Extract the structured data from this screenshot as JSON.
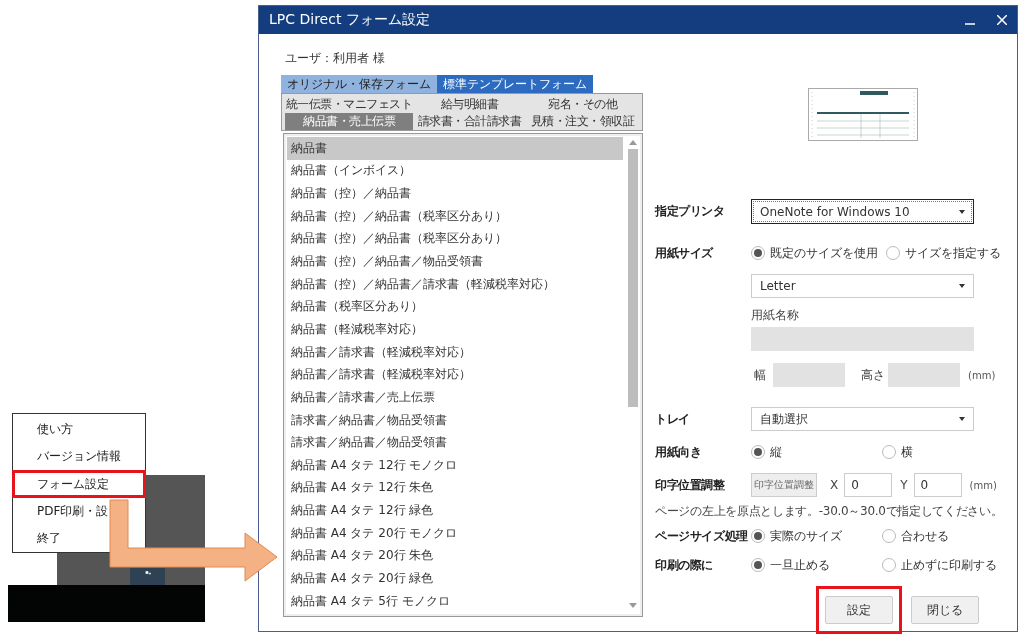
{
  "context_menu": {
    "items": [
      {
        "label": "使い方",
        "highlighted": false
      },
      {
        "label": "バージョン情報",
        "highlighted": false
      },
      {
        "label": "フォーム設定",
        "highlighted": true
      },
      {
        "label": "PDF印刷・設",
        "highlighted": false
      },
      {
        "label": "終了",
        "highlighted": false
      }
    ]
  },
  "window": {
    "title": "LPC Direct フォーム設定"
  },
  "user_label": "ユーザ：利用者 様",
  "source_tabs": [
    {
      "label": "オリジナル・保存フォーム",
      "selected": false
    },
    {
      "label": "標準テンプレートフォーム",
      "selected": true
    }
  ],
  "category_tab_rows": [
    {
      "tabs": [
        {
          "label": "統一伝票・マニフェスト",
          "selected": false
        },
        {
          "label": "給与明細書",
          "selected": false
        },
        {
          "label": "宛名・その他",
          "selected": false
        }
      ]
    },
    {
      "tabs": [
        {
          "label": "納品書・売上伝票",
          "selected": true
        },
        {
          "label": "請求書・合計請求書",
          "selected": false
        },
        {
          "label": "見積・注文・領収証",
          "selected": false
        }
      ]
    }
  ],
  "form_list": {
    "items": [
      {
        "label": "納品書",
        "selected": true
      },
      {
        "label": "納品書（インボイス）",
        "selected": false
      },
      {
        "label": "納品書（控）／納品書",
        "selected": false
      },
      {
        "label": "納品書（控）／納品書（税率区分あり）",
        "selected": false
      },
      {
        "label": "納品書（控）／納品書（税率区分あり）",
        "selected": false
      },
      {
        "label": "納品書（控）／納品書／物品受領書",
        "selected": false
      },
      {
        "label": "納品書（控）／納品書／請求書（軽減税率対応）",
        "selected": false
      },
      {
        "label": "納品書（税率区分あり）",
        "selected": false
      },
      {
        "label": "納品書（軽減税率対応）",
        "selected": false
      },
      {
        "label": "納品書／請求書（軽減税率対応）",
        "selected": false
      },
      {
        "label": "納品書／請求書（軽減税率対応）",
        "selected": false
      },
      {
        "label": "納品書／請求書／売上伝票",
        "selected": false
      },
      {
        "label": "請求書／納品書／物品受領書",
        "selected": false
      },
      {
        "label": "請求書／納品書／物品受領書",
        "selected": false
      },
      {
        "label": "納品書 A4 タテ 12行 モノクロ",
        "selected": false
      },
      {
        "label": "納品書 A4 タテ 12行 朱色",
        "selected": false
      },
      {
        "label": "納品書 A4 タテ 12行 緑色",
        "selected": false
      },
      {
        "label": "納品書 A4 タテ 20行 モノクロ",
        "selected": false
      },
      {
        "label": "納品書 A4 タテ 20行 朱色",
        "selected": false
      },
      {
        "label": "納品書 A4 タテ 20行 緑色",
        "selected": false
      },
      {
        "label": "納品書 A4 タテ 5行 モノクロ",
        "selected": false
      }
    ]
  },
  "printer": {
    "label": "指定プリンタ",
    "value": "OneNote for Windows 10"
  },
  "paper_size": {
    "label": "用紙サイズ",
    "options": [
      {
        "label": "既定のサイズを使用",
        "selected": true
      },
      {
        "label": "サイズを指定する",
        "selected": false
      }
    ],
    "size_value": "Letter",
    "name_label": "用紙名称",
    "width_label": "幅",
    "height_label": "高さ",
    "unit": "(mm)"
  },
  "tray": {
    "label": "トレイ",
    "value": "自動選択"
  },
  "orientation": {
    "label": "用紙向き",
    "options": [
      {
        "label": "縦",
        "selected": true
      },
      {
        "label": "横",
        "selected": false
      }
    ]
  },
  "offset": {
    "label": "印字位置調整",
    "button": "印字位置調整",
    "x_label": "X",
    "x_value": "0",
    "y_label": "Y",
    "y_value": "0",
    "unit": "(mm)",
    "hint": "ページの左上を原点とします。-30.0～30.0で指定してください。"
  },
  "page_size_handling": {
    "label": "ページサイズ処理",
    "options": [
      {
        "label": "実際のサイズ",
        "selected": true
      },
      {
        "label": "合わせる",
        "selected": false
      }
    ]
  },
  "on_print": {
    "label": "印刷の際に",
    "options": [
      {
        "label": "一旦止める",
        "selected": true
      },
      {
        "label": "止めずに印刷する",
        "selected": false
      }
    ]
  },
  "buttons": [
    {
      "label": "設定",
      "highlighted": true
    },
    {
      "label": "閉じる",
      "highlighted": false
    }
  ]
}
